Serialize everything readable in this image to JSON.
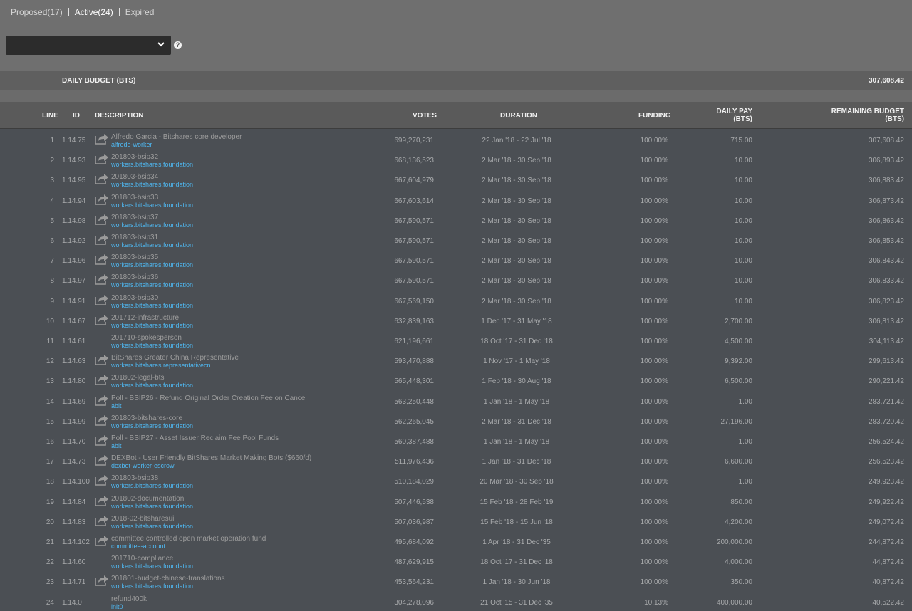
{
  "tabs": [
    {
      "label": "Proposed(17)"
    },
    {
      "label": "Active(24)"
    },
    {
      "label": "Expired"
    }
  ],
  "filter": {
    "value": "",
    "help_icon": "?"
  },
  "daily_budget": {
    "label": "DAILY BUDGET (BTS)",
    "value": "307,608.42"
  },
  "columns": {
    "line": "LINE",
    "id": "ID",
    "description": "DESCRIPTION",
    "votes": "VOTES",
    "duration": "DURATION",
    "funding": "FUNDING",
    "daily_pay_1": "DAILY PAY",
    "daily_pay_2": "(BTS)",
    "remaining_1": "REMAINING BUDGET",
    "remaining_2": "(BTS)"
  },
  "rows": [
    {
      "line": "1",
      "id": "1.14.75",
      "icon": true,
      "title": "Alfredo Garcia - Bitshares core developer",
      "account": "alfredo-worker",
      "votes": "699,270,231",
      "duration": "22 Jan '18 - 22 Jul '18",
      "funding": "100.00%",
      "pay": "715.00",
      "remaining": "307,608.42"
    },
    {
      "line": "2",
      "id": "1.14.93",
      "icon": true,
      "title": "201803-bsip32",
      "account": "workers.bitshares.foundation",
      "votes": "668,136,523",
      "duration": "2 Mar '18 - 30 Sep '18",
      "funding": "100.00%",
      "pay": "10.00",
      "remaining": "306,893.42"
    },
    {
      "line": "3",
      "id": "1.14.95",
      "icon": true,
      "title": "201803-bsip34",
      "account": "workers.bitshares.foundation",
      "votes": "667,604,979",
      "duration": "2 Mar '18 - 30 Sep '18",
      "funding": "100.00%",
      "pay": "10.00",
      "remaining": "306,883.42"
    },
    {
      "line": "4",
      "id": "1.14.94",
      "icon": true,
      "title": "201803-bsip33",
      "account": "workers.bitshares.foundation",
      "votes": "667,603,614",
      "duration": "2 Mar '18 - 30 Sep '18",
      "funding": "100.00%",
      "pay": "10.00",
      "remaining": "306,873.42"
    },
    {
      "line": "5",
      "id": "1.14.98",
      "icon": true,
      "title": "201803-bsip37",
      "account": "workers.bitshares.foundation",
      "votes": "667,590,571",
      "duration": "2 Mar '18 - 30 Sep '18",
      "funding": "100.00%",
      "pay": "10.00",
      "remaining": "306,863.42"
    },
    {
      "line": "6",
      "id": "1.14.92",
      "icon": true,
      "title": "201803-bsip31",
      "account": "workers.bitshares.foundation",
      "votes": "667,590,571",
      "duration": "2 Mar '18 - 30 Sep '18",
      "funding": "100.00%",
      "pay": "10.00",
      "remaining": "306,853.42"
    },
    {
      "line": "7",
      "id": "1.14.96",
      "icon": true,
      "title": "201803-bsip35",
      "account": "workers.bitshares.foundation",
      "votes": "667,590,571",
      "duration": "2 Mar '18 - 30 Sep '18",
      "funding": "100.00%",
      "pay": "10.00",
      "remaining": "306,843.42"
    },
    {
      "line": "8",
      "id": "1.14.97",
      "icon": true,
      "title": "201803-bsip36",
      "account": "workers.bitshares.foundation",
      "votes": "667,590,571",
      "duration": "2 Mar '18 - 30 Sep '18",
      "funding": "100.00%",
      "pay": "10.00",
      "remaining": "306,833.42"
    },
    {
      "line": "9",
      "id": "1.14.91",
      "icon": true,
      "title": "201803-bsip30",
      "account": "workers.bitshares.foundation",
      "votes": "667,569,150",
      "duration": "2 Mar '18 - 30 Sep '18",
      "funding": "100.00%",
      "pay": "10.00",
      "remaining": "306,823.42"
    },
    {
      "line": "10",
      "id": "1.14.67",
      "icon": true,
      "title": "201712-infrastructure",
      "account": "workers.bitshares.foundation",
      "votes": "632,839,163",
      "duration": "1 Dec '17 - 31 May '18",
      "funding": "100.00%",
      "pay": "2,700.00",
      "remaining": "306,813.42"
    },
    {
      "line": "11",
      "id": "1.14.61",
      "icon": false,
      "title": "201710-spokesperson",
      "account": "workers.bitshares.foundation",
      "votes": "621,196,661",
      "duration": "18 Oct '17 - 31 Dec '18",
      "funding": "100.00%",
      "pay": "4,500.00",
      "remaining": "304,113.42"
    },
    {
      "line": "12",
      "id": "1.14.63",
      "icon": true,
      "title": "BitShares Greater China Representative",
      "account": "workers.bitshares.representativecn",
      "votes": "593,470,888",
      "duration": "1 Nov '17 - 1 May '18",
      "funding": "100.00%",
      "pay": "9,392.00",
      "remaining": "299,613.42"
    },
    {
      "line": "13",
      "id": "1.14.80",
      "icon": true,
      "title": "201802-legal-bts",
      "account": "workers.bitshares.foundation",
      "votes": "565,448,301",
      "duration": "1 Feb '18 - 30 Aug '18",
      "funding": "100.00%",
      "pay": "6,500.00",
      "remaining": "290,221.42"
    },
    {
      "line": "14",
      "id": "1.14.69",
      "icon": true,
      "title": "Poll - BSIP26 - Refund Original Order Creation Fee on Cancel",
      "account": "abit",
      "votes": "563,250,448",
      "duration": "1 Jan '18 - 1 May '18",
      "funding": "100.00%",
      "pay": "1.00",
      "remaining": "283,721.42"
    },
    {
      "line": "15",
      "id": "1.14.99",
      "icon": true,
      "title": "201803-bitshares-core",
      "account": "workers.bitshares.foundation",
      "votes": "562,265,045",
      "duration": "2 Mar '18 - 31 Dec '18",
      "funding": "100.00%",
      "pay": "27,196.00",
      "remaining": "283,720.42"
    },
    {
      "line": "16",
      "id": "1.14.70",
      "icon": true,
      "title": "Poll - BSIP27 - Asset Issuer Reclaim Fee Pool Funds",
      "account": "abit",
      "votes": "560,387,488",
      "duration": "1 Jan '18 - 1 May '18",
      "funding": "100.00%",
      "pay": "1.00",
      "remaining": "256,524.42"
    },
    {
      "line": "17",
      "id": "1.14.73",
      "icon": true,
      "title": "DEXBot - User Friendly BitShares Market Making Bots ($660/d)",
      "account": "dexbot-worker-escrow",
      "votes": "511,976,436",
      "duration": "1 Jan '18 - 31 Dec '18",
      "funding": "100.00%",
      "pay": "6,600.00",
      "remaining": "256,523.42"
    },
    {
      "line": "18",
      "id": "1.14.100",
      "icon": true,
      "title": "201803-bsip38",
      "account": "workers.bitshares.foundation",
      "votes": "510,184,029",
      "duration": "20 Mar '18 - 30 Sep '18",
      "funding": "100.00%",
      "pay": "1.00",
      "remaining": "249,923.42"
    },
    {
      "line": "19",
      "id": "1.14.84",
      "icon": true,
      "title": "201802-documentation",
      "account": "workers.bitshares.foundation",
      "votes": "507,446,538",
      "duration": "15 Feb '18 - 28 Feb '19",
      "funding": "100.00%",
      "pay": "850.00",
      "remaining": "249,922.42"
    },
    {
      "line": "20",
      "id": "1.14.83",
      "icon": true,
      "title": "2018-02-bitsharesui",
      "account": "workers.bitshares.foundation",
      "votes": "507,036,987",
      "duration": "15 Feb '18 - 15 Jun '18",
      "funding": "100.00%",
      "pay": "4,200.00",
      "remaining": "249,072.42"
    },
    {
      "line": "21",
      "id": "1.14.102",
      "icon": true,
      "title": "committee controlled open market operation fund",
      "account": "committee-account",
      "votes": "495,684,092",
      "duration": "1 Apr '18 - 31 Dec '35",
      "funding": "100.00%",
      "pay": "200,000.00",
      "remaining": "244,872.42"
    },
    {
      "line": "22",
      "id": "1.14.60",
      "icon": false,
      "title": "201710-compliance",
      "account": "workers.bitshares.foundation",
      "votes": "487,629,915",
      "duration": "18 Oct '17 - 31 Dec '18",
      "funding": "100.00%",
      "pay": "4,000.00",
      "remaining": "44,872.42"
    },
    {
      "line": "23",
      "id": "1.14.71",
      "icon": true,
      "title": "201801-budget-chinese-translations",
      "account": "workers.bitshares.foundation",
      "votes": "453,564,231",
      "duration": "1 Jan '18 - 30 Jun '18",
      "funding": "100.00%",
      "pay": "350.00",
      "remaining": "40,872.42"
    },
    {
      "line": "24",
      "id": "1.14.0",
      "icon": false,
      "title": "refund400k",
      "account": "init0",
      "votes": "304,278,096",
      "duration": "21 Oct '15 - 31 Dec '35",
      "funding": "10.13%",
      "pay": "400,000.00",
      "remaining": "40,522.42"
    }
  ]
}
